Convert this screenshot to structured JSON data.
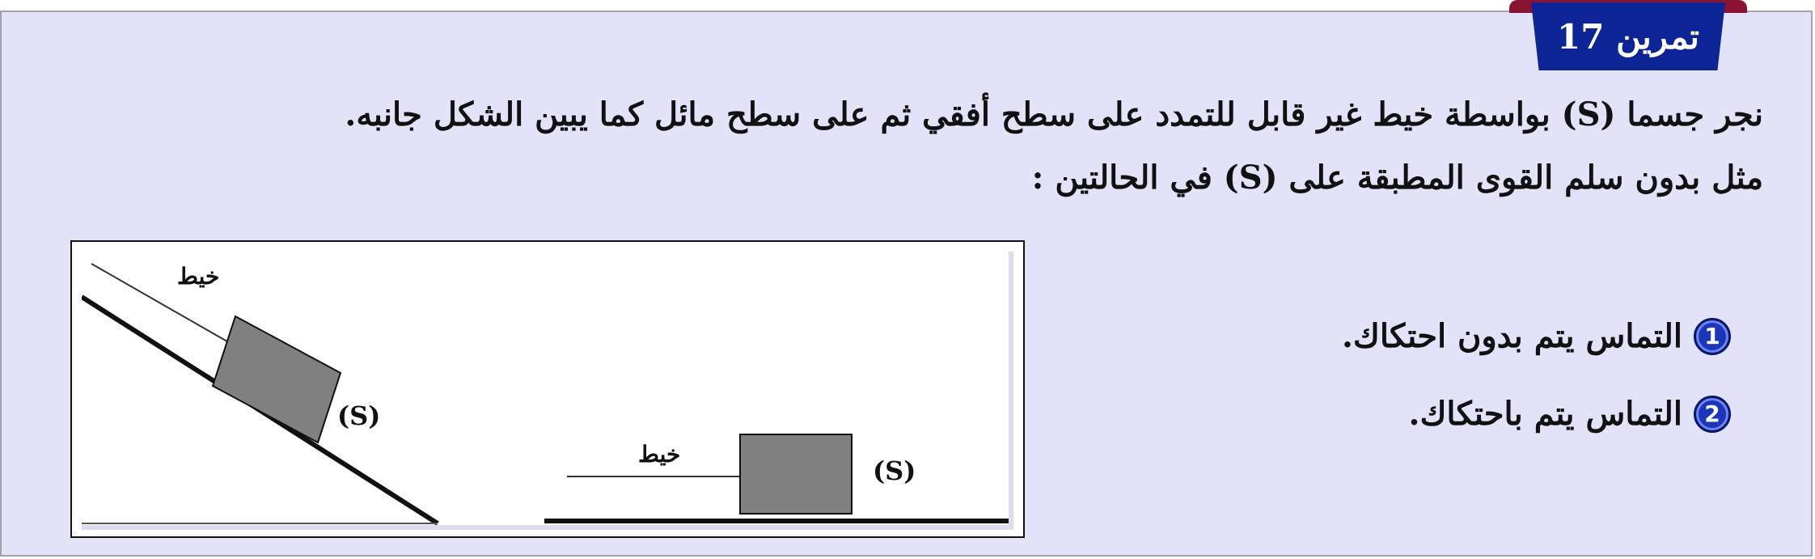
{
  "header": {
    "exercise_label": "تمرين 17"
  },
  "statement": {
    "line1": "نجر جسما (S) بواسطة خيط غير قابل للتمدد على سطح أفقي ثم على سطح مائل كما يبين الشكل جانبه.",
    "line2": "مثل بدون سلم القوى المطبقة على (S) في الحالتين :"
  },
  "figure": {
    "incline_string_label": "خيط",
    "incline_body_label": "(S)",
    "horizontal_string_label": "خيط",
    "horizontal_body_label": "(S)"
  },
  "cases": [
    {
      "number": "1",
      "text": "التماس يتم بدون احتكاك."
    },
    {
      "number": "2",
      "text": "التماس يتم باحتكاك."
    }
  ],
  "colors": {
    "frame_background": "#e2e2f8",
    "tab_blue": "#0c2496",
    "tab_ribbon": "#8a1232",
    "badge_blue": "#1b36b8",
    "body_gray": "#808080"
  }
}
